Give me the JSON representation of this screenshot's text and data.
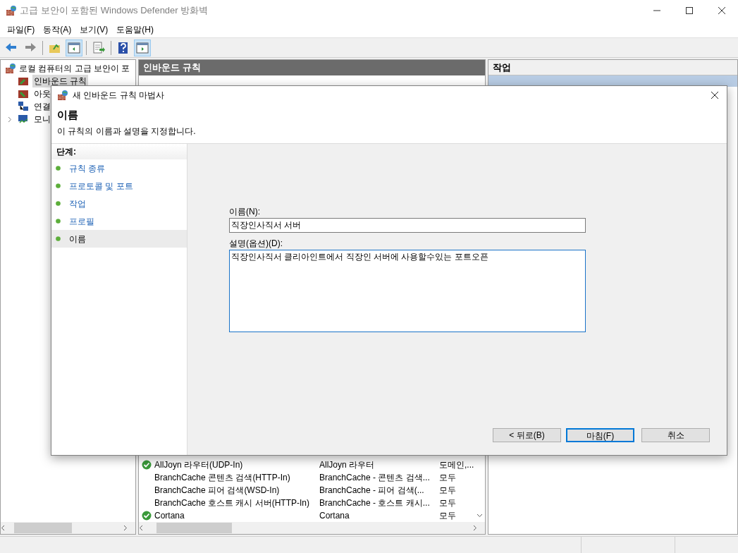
{
  "window": {
    "title": "고급 보안이 포함된 Windows Defender 방화벽"
  },
  "menu": [
    "파일(F)",
    "동작(A)",
    "보기(V)",
    "도움말(H)"
  ],
  "tree": {
    "root": "로컬 컴퓨터의 고급 보안이 포",
    "items": [
      {
        "label": "인바운드 규칙",
        "selected": true,
        "expandable": false
      },
      {
        "label": "아웃",
        "selected": false,
        "expandable": false
      },
      {
        "label": "연결",
        "selected": false,
        "expandable": false
      },
      {
        "label": "모니",
        "selected": false,
        "expandable": true
      }
    ]
  },
  "center": {
    "title": "인바운드 규칙",
    "rows": [
      {
        "name": "AllJoyn 라우터(UDP-In)",
        "group": "AllJoyn 라우터",
        "profile": "도메인,...",
        "enabled": true
      },
      {
        "name": "BranchCache 콘텐츠 검색(HTTP-In)",
        "group": "BranchCache - 콘텐츠 검색...",
        "profile": "모두",
        "enabled": false
      },
      {
        "name": "BranchCache 피어 검색(WSD-In)",
        "group": "BranchCache - 피어 검색(...",
        "profile": "모두",
        "enabled": false
      },
      {
        "name": "BranchCache 호스트 캐시 서버(HTTP-In)",
        "group": "BranchCache - 호스트 캐시...",
        "profile": "모두",
        "enabled": false
      },
      {
        "name": "Cortana",
        "group": "Cortana",
        "profile": "모두",
        "enabled": true
      }
    ]
  },
  "actions": {
    "title": "작업"
  },
  "dialog": {
    "title": "새 인바운드 규칙 마법사",
    "heading": "이름",
    "subtitle": "이 규칙의 이름과 설명을 지정합니다.",
    "steps_label": "단계:",
    "steps": [
      {
        "label": "규칙 종류",
        "selected": false
      },
      {
        "label": "프로토콜 및 포트",
        "selected": false
      },
      {
        "label": "작업",
        "selected": false
      },
      {
        "label": "프로필",
        "selected": false
      },
      {
        "label": "이름",
        "selected": true
      }
    ],
    "name_label": "이름(N):",
    "name_value": "직장인사직서 서버",
    "desc_label": "설명(옵션)(D):",
    "desc_value": "직장인사직서 클리아인트에서 직장인 서버에 사용할수있는 포트오픈",
    "buttons": [
      {
        "label": "< 뒤로(B)",
        "default": false
      },
      {
        "label": "마침(F)",
        "default": true
      },
      {
        "label": "취소",
        "default": false
      }
    ]
  }
}
